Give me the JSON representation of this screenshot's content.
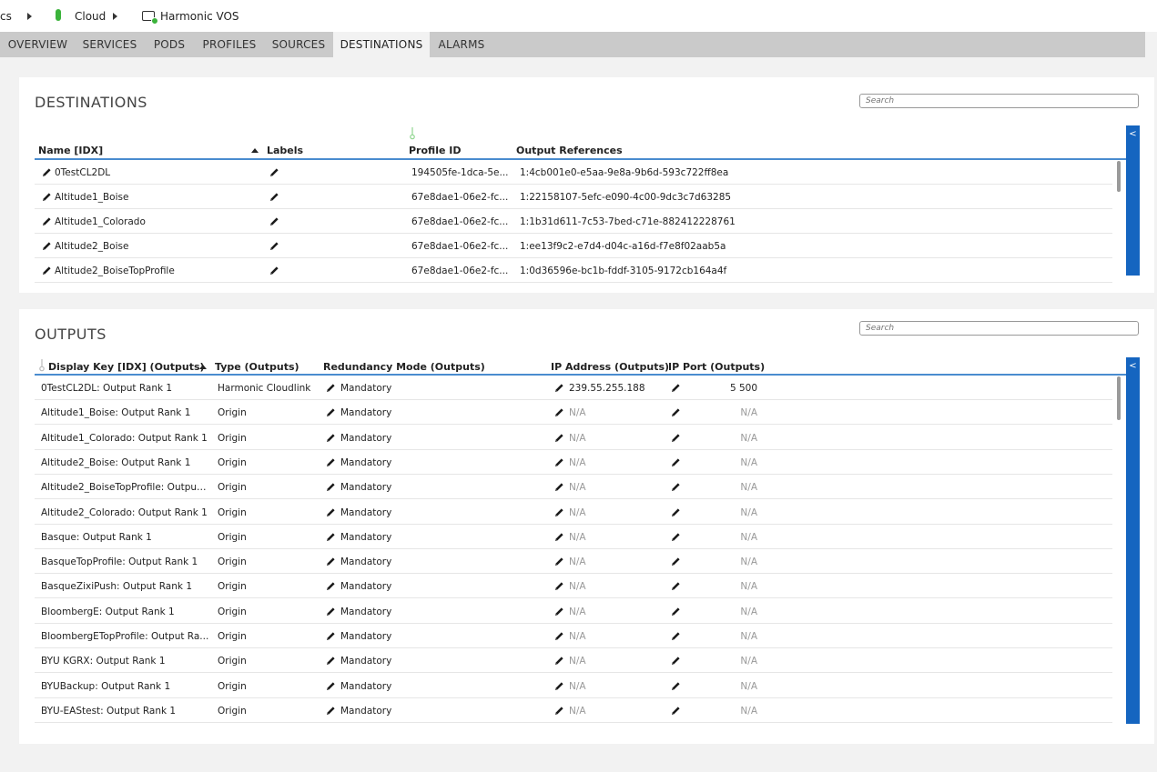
{
  "breadcrumb": {
    "root": "cs",
    "cloud": "Cloud",
    "system": "Harmonic VOS"
  },
  "tabs": [
    "OVERVIEW",
    "SERVICES",
    "PODS",
    "PROFILES",
    "SOURCES",
    "DESTINATIONS",
    "ALARMS"
  ],
  "active_tab": "DESTINATIONS",
  "destinations": {
    "title": "DESTINATIONS",
    "search_placeholder": "Search",
    "collapse_label": "<",
    "columns": {
      "name": "Name [IDX]",
      "labels": "Labels",
      "profile_id": "Profile ID",
      "output_refs": "Output References"
    },
    "rows": [
      {
        "name": "0TestCL2DL",
        "profile_id": "194505fe-1dca-5e...",
        "output_refs": "1:4cb001e0-e5aa-9e8a-9b6d-593c722ff8ea"
      },
      {
        "name": "Altitude1_Boise",
        "profile_id": "67e8dae1-06e2-fc...",
        "output_refs": "1:22158107-5efc-e090-4c00-9dc3c7d63285"
      },
      {
        "name": "Altitude1_Colorado",
        "profile_id": "67e8dae1-06e2-fc...",
        "output_refs": "1:1b31d611-7c53-7bed-c71e-882412228761"
      },
      {
        "name": "Altitude2_Boise",
        "profile_id": "67e8dae1-06e2-fc...",
        "output_refs": "1:ee13f9c2-e7d4-d04c-a16d-f7e8f02aab5a"
      },
      {
        "name": "Altitude2_BoiseTopProfile",
        "profile_id": "67e8dae1-06e2-fc...",
        "output_refs": "1:0d36596e-bc1b-fddf-3105-9172cb164a4f"
      }
    ]
  },
  "outputs": {
    "title": "OUTPUTS",
    "search_placeholder": "Search",
    "collapse_label": "<",
    "columns": {
      "display_key": "Display Key [IDX] (Outputs)",
      "type": "Type (Outputs)",
      "redundancy": "Redundancy Mode (Outputs)",
      "ip_address": "IP Address (Outputs)",
      "ip_port": "IP Port (Outputs)"
    },
    "rows": [
      {
        "key": "0TestCL2DL: Output Rank 1",
        "type": "Harmonic Cloudlink",
        "redundancy": "Mandatory",
        "ip": "239.55.255.188",
        "port": "5 500"
      },
      {
        "key": "Altitude1_Boise: Output Rank 1",
        "type": "Origin",
        "redundancy": "Mandatory",
        "ip": "N/A",
        "port": "N/A"
      },
      {
        "key": "Altitude1_Colorado: Output Rank 1",
        "type": "Origin",
        "redundancy": "Mandatory",
        "ip": "N/A",
        "port": "N/A"
      },
      {
        "key": "Altitude2_Boise: Output Rank 1",
        "type": "Origin",
        "redundancy": "Mandatory",
        "ip": "N/A",
        "port": "N/A"
      },
      {
        "key": "Altitude2_BoiseTopProfile: Output...",
        "type": "Origin",
        "redundancy": "Mandatory",
        "ip": "N/A",
        "port": "N/A"
      },
      {
        "key": "Altitude2_Colorado: Output Rank 1",
        "type": "Origin",
        "redundancy": "Mandatory",
        "ip": "N/A",
        "port": "N/A"
      },
      {
        "key": "Basque: Output Rank 1",
        "type": "Origin",
        "redundancy": "Mandatory",
        "ip": "N/A",
        "port": "N/A"
      },
      {
        "key": "BasqueTopProfile: Output Rank 1",
        "type": "Origin",
        "redundancy": "Mandatory",
        "ip": "N/A",
        "port": "N/A"
      },
      {
        "key": "BasqueZixiPush: Output Rank 1",
        "type": "Origin",
        "redundancy": "Mandatory",
        "ip": "N/A",
        "port": "N/A"
      },
      {
        "key": "BloombergE: Output Rank 1",
        "type": "Origin",
        "redundancy": "Mandatory",
        "ip": "N/A",
        "port": "N/A"
      },
      {
        "key": "BloombergETopProfile: Output Ra...",
        "type": "Origin",
        "redundancy": "Mandatory",
        "ip": "N/A",
        "port": "N/A"
      },
      {
        "key": "BYU KGRX: Output Rank 1",
        "type": "Origin",
        "redundancy": "Mandatory",
        "ip": "N/A",
        "port": "N/A"
      },
      {
        "key": "BYUBackup: Output Rank 1",
        "type": "Origin",
        "redundancy": "Mandatory",
        "ip": "N/A",
        "port": "N/A"
      },
      {
        "key": "BYU-EAStest: Output Rank 1",
        "type": "Origin",
        "redundancy": "Mandatory",
        "ip": "N/A",
        "port": "N/A"
      }
    ]
  },
  "colors": {
    "accent_blue": "#1565c0",
    "header_line": "#4a8ccf",
    "status_green": "#3bb33b",
    "tab_bar": "#cacaca"
  },
  "icons": [
    "pencil-icon",
    "sort-ascending-icon",
    "key-icon",
    "cloud-status-icon",
    "vos-system-icon",
    "chevron-left-icon"
  ]
}
